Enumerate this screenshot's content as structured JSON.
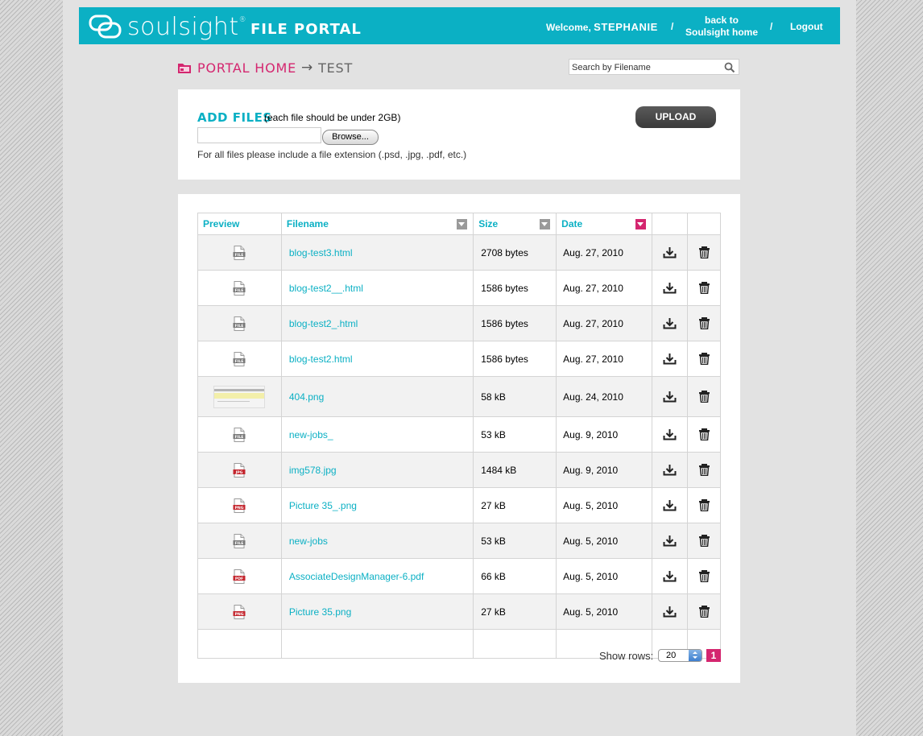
{
  "header": {
    "logo_text": "soulsight",
    "logo_mark": "®",
    "portal_title": "FILE PORTAL",
    "welcome_prefix": "Welcome,",
    "welcome_name": "STEPHANIE",
    "separator": "/",
    "back_home_line1": "back to",
    "back_home_line2": "Soulsight home",
    "logout": "Logout",
    "brand_color": "#0bb0c4"
  },
  "breadcrumb": {
    "home": "PORTAL HOME",
    "arrow": "→",
    "current": "TEST",
    "accent_color": "#d4266f"
  },
  "search": {
    "placeholder": "Search by Filename"
  },
  "upload": {
    "title": "ADD FILES",
    "note": "(each file should be under 2GB)",
    "browse_label": "Browse...",
    "ext_note": "For all files please include a file extension (.psd, .jpg, .pdf, etc.)",
    "upload_label": "UPLOAD"
  },
  "table": {
    "headers": {
      "preview": "Preview",
      "filename": "Filename",
      "size": "Size",
      "date": "Date"
    },
    "rows": [
      {
        "icon": "file-icon",
        "name": "blog-test3.html",
        "size": "2708 bytes",
        "date": "Aug. 27, 2010"
      },
      {
        "icon": "file-icon",
        "name": "blog-test2__.html",
        "size": "1586 bytes",
        "date": "Aug. 27, 2010"
      },
      {
        "icon": "file-icon",
        "name": "blog-test2_.html",
        "size": "1586 bytes",
        "date": "Aug. 27, 2010"
      },
      {
        "icon": "file-icon",
        "name": "blog-test2.html",
        "size": "1586 bytes",
        "date": "Aug. 27, 2010"
      },
      {
        "icon": "image-thumbnail",
        "name": "404.png",
        "size": "58 kB",
        "date": "Aug. 24, 2010"
      },
      {
        "icon": "file-icon",
        "name": "new-jobs_",
        "size": "53 kB",
        "date": "Aug. 9, 2010"
      },
      {
        "icon": "jpg-file-icon",
        "name": "img578.jpg",
        "size": "1484 kB",
        "date": "Aug. 9, 2010"
      },
      {
        "icon": "png-file-icon",
        "name": "Picture 35_.png",
        "size": "27 kB",
        "date": "Aug. 5, 2010"
      },
      {
        "icon": "file-icon",
        "name": "new-jobs",
        "size": "53 kB",
        "date": "Aug. 5, 2010"
      },
      {
        "icon": "pdf-file-icon",
        "name": "AssociateDesignManager-6.pdf",
        "size": "66 kB",
        "date": "Aug. 5, 2010"
      },
      {
        "icon": "png-file-icon",
        "name": "Picture 35.png",
        "size": "27 kB",
        "date": "Aug. 5, 2010"
      }
    ]
  },
  "pagination": {
    "show_rows_label": "Show rows:",
    "rows_value": "20",
    "current_page": "1"
  }
}
